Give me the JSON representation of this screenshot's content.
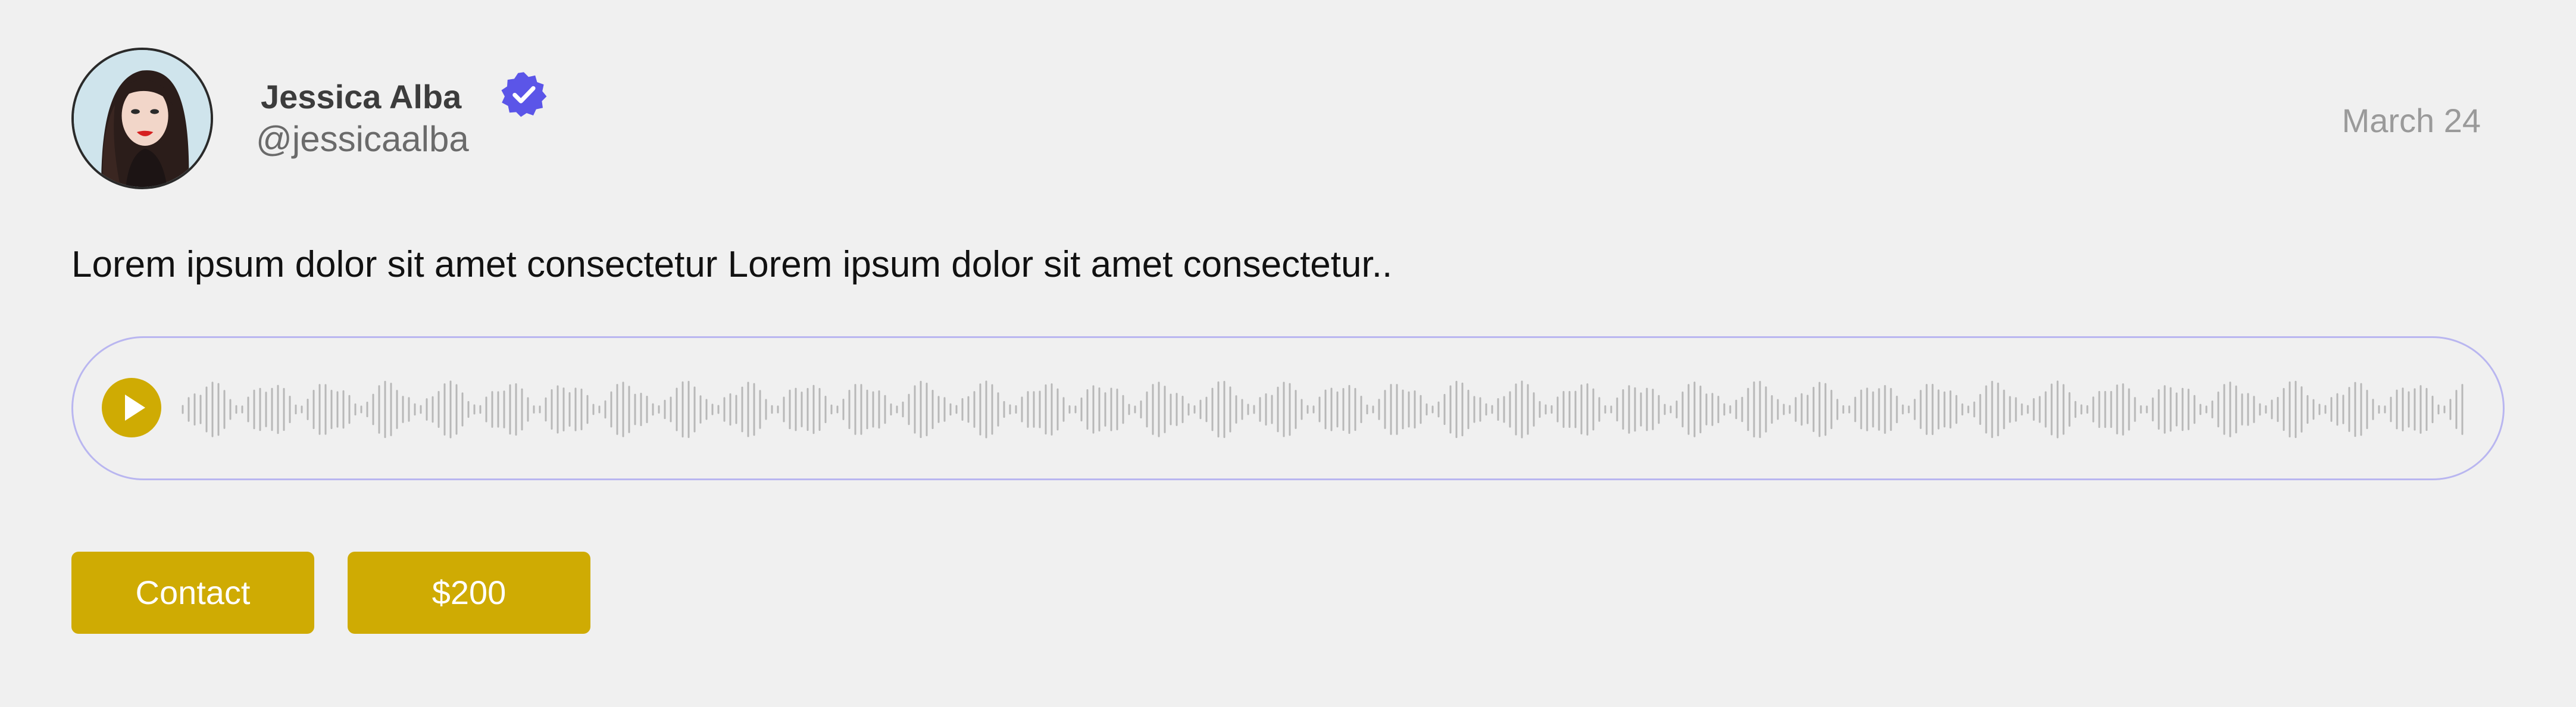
{
  "user": {
    "name": "Jessica Alba",
    "handle": "@jessicaalba",
    "verified": true,
    "avatar": "portrait-photo"
  },
  "post": {
    "date": "March 24",
    "text": "Lorem ipsum dolor sit amet consectetur Lorem ipsum dolor sit amet consectetur.."
  },
  "audio": {
    "play_icon": "play-icon",
    "progress": 0
  },
  "actions": {
    "contact_label": "Contact",
    "price_label": "$200"
  },
  "colors": {
    "background": "#f0f0f0",
    "accent": "#cfab03",
    "verified_badge": "#5b55e8",
    "player_border": "#b9b6f0",
    "waveform": "#b8b8b8"
  }
}
